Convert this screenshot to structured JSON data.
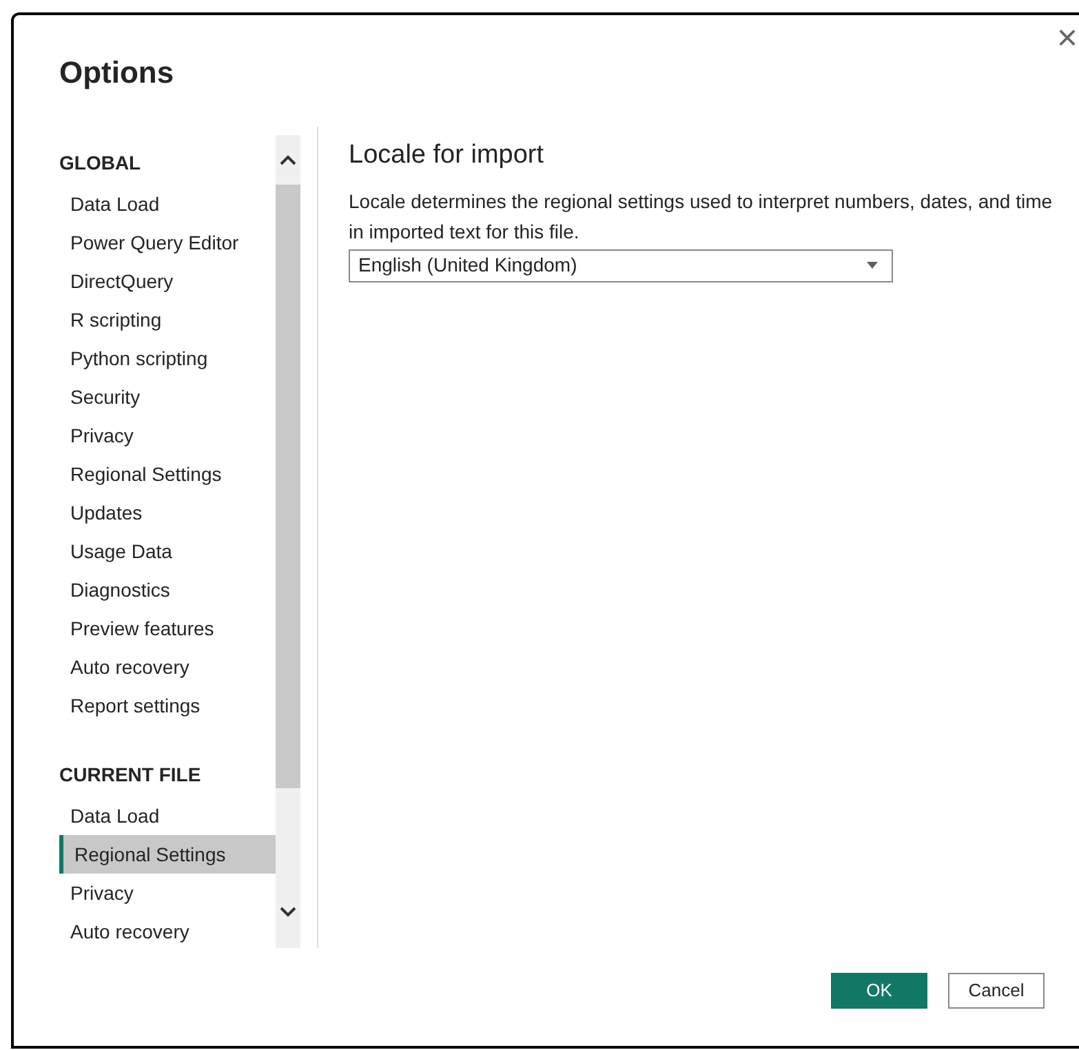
{
  "window": {
    "title": "Options",
    "close": "×"
  },
  "sidebar": {
    "sections": [
      {
        "heading": "GLOBAL",
        "items": [
          {
            "label": "Data Load",
            "selected": false
          },
          {
            "label": "Power Query Editor",
            "selected": false
          },
          {
            "label": "DirectQuery",
            "selected": false
          },
          {
            "label": "R scripting",
            "selected": false
          },
          {
            "label": "Python scripting",
            "selected": false
          },
          {
            "label": "Security",
            "selected": false
          },
          {
            "label": "Privacy",
            "selected": false
          },
          {
            "label": "Regional Settings",
            "selected": false
          },
          {
            "label": "Updates",
            "selected": false
          },
          {
            "label": "Usage Data",
            "selected": false
          },
          {
            "label": "Diagnostics",
            "selected": false
          },
          {
            "label": "Preview features",
            "selected": false
          },
          {
            "label": "Auto recovery",
            "selected": false
          },
          {
            "label": "Report settings",
            "selected": false
          }
        ]
      },
      {
        "heading": "CURRENT FILE",
        "items": [
          {
            "label": "Data Load",
            "selected": false
          },
          {
            "label": "Regional Settings",
            "selected": true
          },
          {
            "label": "Privacy",
            "selected": false
          },
          {
            "label": "Auto recovery",
            "selected": false
          }
        ]
      }
    ]
  },
  "content": {
    "heading": "Locale for import",
    "description": "Locale determines the regional settings used to interpret numbers, dates, and time in imported text for this file.",
    "locale_select": {
      "value": "English (United Kingdom)"
    }
  },
  "buttons": [
    {
      "label": "OK",
      "kind": "primary"
    },
    {
      "label": "Cancel",
      "kind": "secondary"
    }
  ]
}
